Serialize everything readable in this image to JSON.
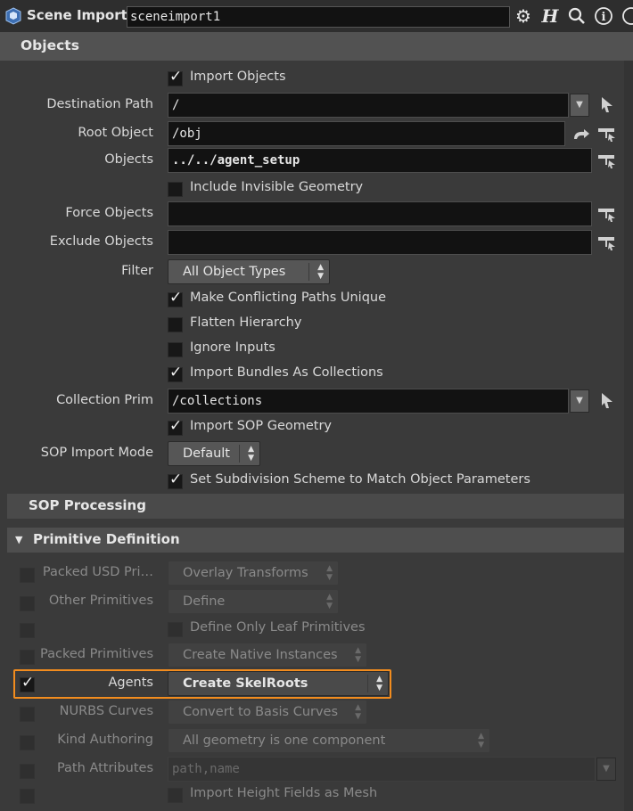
{
  "header": {
    "title": "Scene Import",
    "node_name": "sceneimport1",
    "icons": [
      "gear-icon",
      "help-h-icon",
      "search-icon",
      "info-icon",
      "help-icon"
    ]
  },
  "tab": {
    "label": "Objects"
  },
  "objects": {
    "import_objects": {
      "label": "Import Objects",
      "checked": true
    },
    "destination_path": {
      "label": "Destination Path",
      "value": "/"
    },
    "root_object": {
      "label": "Root Object",
      "value": "/obj"
    },
    "objects_field": {
      "label": "Objects",
      "value": "../../agent_setup"
    },
    "include_invisible": {
      "label": "Include Invisible Geometry",
      "checked": false
    },
    "force_objects": {
      "label": "Force Objects",
      "value": ""
    },
    "exclude_objects": {
      "label": "Exclude Objects",
      "value": ""
    },
    "filter": {
      "label": "Filter",
      "value": "All Object Types"
    },
    "make_unique": {
      "label": "Make Conflicting Paths Unique",
      "checked": true
    },
    "flatten": {
      "label": "Flatten Hierarchy",
      "checked": false
    },
    "ignore_inputs": {
      "label": "Ignore Inputs",
      "checked": false
    },
    "bundles": {
      "label": "Import Bundles As Collections",
      "checked": true
    },
    "collection_prim": {
      "label": "Collection Prim",
      "value": "/collections"
    },
    "import_sop": {
      "label": "Import SOP Geometry",
      "checked": true
    },
    "sop_mode": {
      "label": "SOP Import Mode",
      "value": "Default"
    },
    "subdiv": {
      "label": "Set Subdivision Scheme to Match Object Parameters",
      "checked": true
    }
  },
  "sop_processing": {
    "label": "SOP Processing"
  },
  "primitive_definition": {
    "label": "Primitive Definition",
    "packed_usd": {
      "label": "Packed USD Pri…",
      "value": "Overlay Transforms"
    },
    "other_prims": {
      "label": "Other Primitives",
      "value": "Define"
    },
    "leaf_only": {
      "label": "Define Only Leaf Primitives"
    },
    "packed_prims": {
      "label": "Packed Primitives",
      "value": "Create Native Instances"
    },
    "agents": {
      "label": "Agents",
      "value": "Create SkelRoots",
      "checked": true
    },
    "nurbs": {
      "label": "NURBS Curves",
      "value": "Convert to Basis Curves"
    },
    "kind": {
      "label": "Kind Authoring",
      "value": "All geometry is one component"
    },
    "path_attrs": {
      "label": "Path Attributes",
      "value": "path,name"
    },
    "height_fields": {
      "label": "Import Height Fields as Mesh"
    }
  },
  "colors": {
    "highlight": "#f28c1e",
    "background": "#3a3a3a",
    "field": "#121212"
  }
}
